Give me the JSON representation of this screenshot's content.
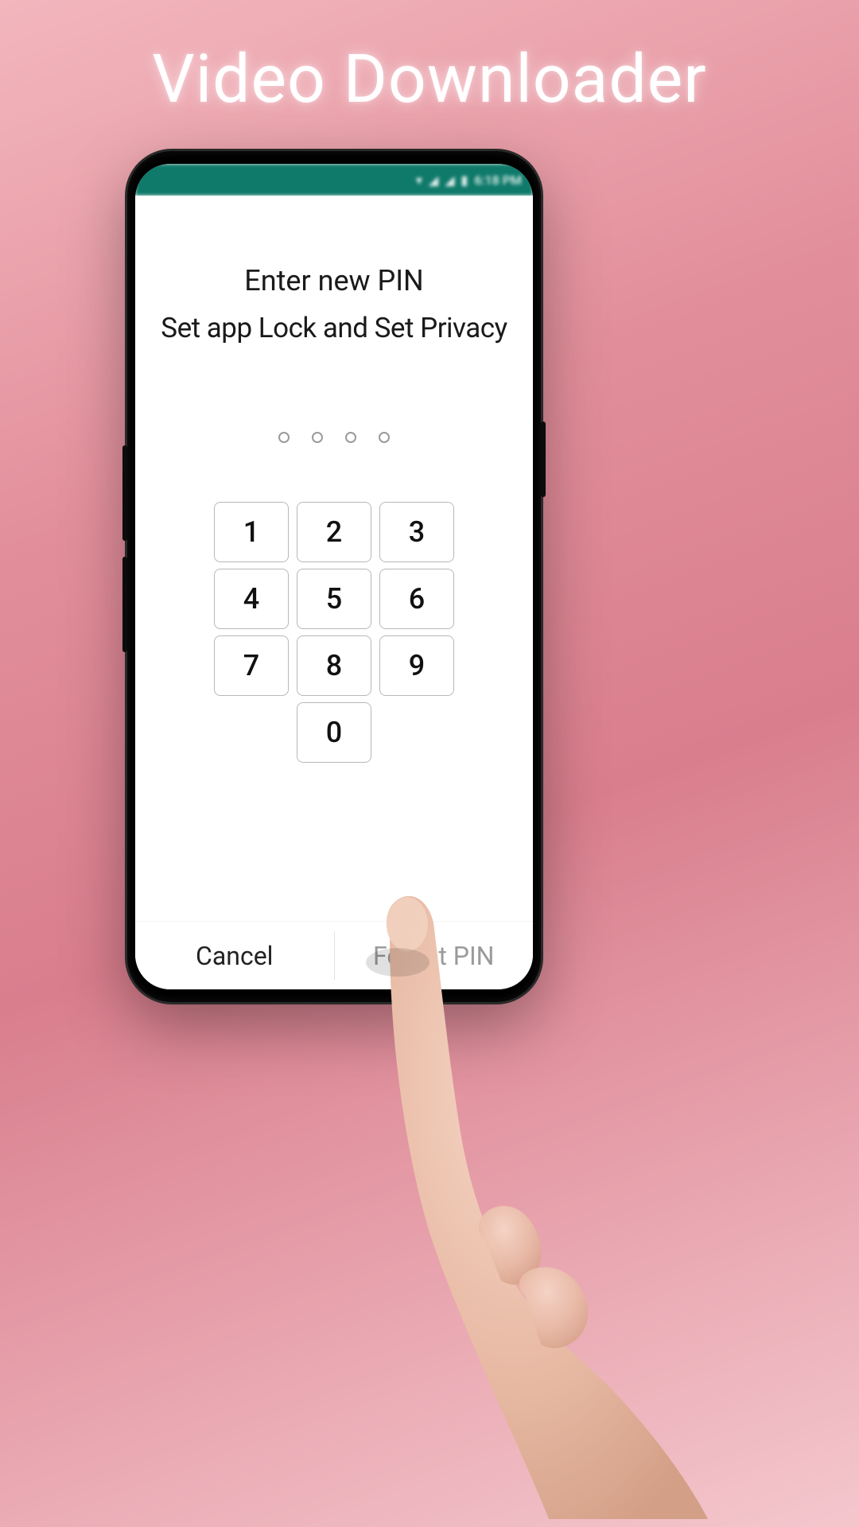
{
  "page": {
    "title": "Video Downloader"
  },
  "statusbar": {
    "time": "6:18 PM"
  },
  "pin": {
    "heading": "Enter new PIN",
    "subheading": "Set app Lock and Set Privacy",
    "length": 4
  },
  "keypad": {
    "rows": [
      [
        "1",
        "2",
        "3"
      ],
      [
        "4",
        "5",
        "6"
      ],
      [
        "7",
        "8",
        "9"
      ],
      [
        "0"
      ]
    ]
  },
  "actions": {
    "cancel": "Cancel",
    "forgot": "Forgot PIN"
  }
}
